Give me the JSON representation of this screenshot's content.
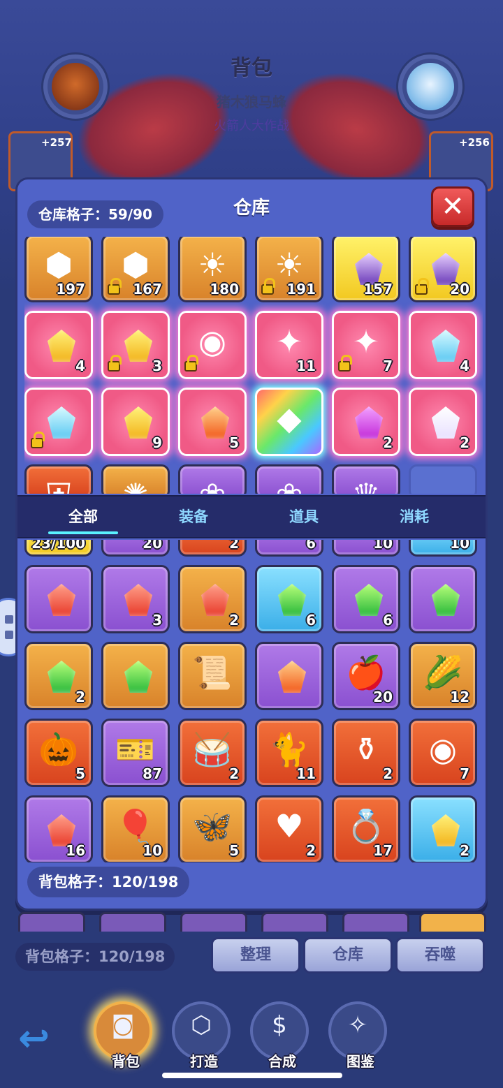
{
  "background": {
    "title": "背包",
    "subtitle": "猪木狼马蜂",
    "subtitle2": "火箭人大作战",
    "left_card_bonus": "+257",
    "right_card_bonus": "+256"
  },
  "warehouse": {
    "title": "仓库",
    "capacity_label": "仓库格子：59/90",
    "close_symbol": "✕",
    "items": [
      {
        "icon": "rune-stone-icon",
        "glyph": "⬢",
        "rarity": "orange",
        "qty": "197",
        "locked": false
      },
      {
        "icon": "rune-stone-icon",
        "glyph": "⬢",
        "rarity": "orange",
        "qty": "167",
        "locked": true
      },
      {
        "icon": "sun-stone-icon",
        "glyph": "☀",
        "rarity": "orange",
        "qty": "180",
        "locked": false
      },
      {
        "icon": "sun-stone-icon",
        "glyph": "☀",
        "rarity": "orange",
        "qty": "191",
        "locked": true
      },
      {
        "icon": "purple-crystal-icon",
        "gem": "purple",
        "rarity": "gold",
        "qty": "157",
        "locked": false
      },
      {
        "icon": "purple-crystal-icon",
        "gem": "purple",
        "rarity": "gold",
        "qty": "20",
        "locked": true
      },
      {
        "icon": "yellow-gem-icon",
        "gem": "yellow",
        "rarity": "pink",
        "qty": "4",
        "locked": false
      },
      {
        "icon": "yellow-gem-icon",
        "gem": "yellow",
        "rarity": "pink",
        "qty": "3",
        "locked": true
      },
      {
        "icon": "purple-orb-icon",
        "glyph": "◉",
        "rarity": "pink",
        "qty": "",
        "locked": true
      },
      {
        "icon": "sparkle-icon",
        "glyph": "✦",
        "rarity": "pink",
        "qty": "11",
        "locked": false
      },
      {
        "icon": "sparkle-icon",
        "glyph": "✦",
        "rarity": "pink",
        "qty": "7",
        "locked": true
      },
      {
        "icon": "ice-crystal-icon",
        "gem": "cyan",
        "rarity": "pink",
        "qty": "4",
        "locked": false
      },
      {
        "icon": "ice-crystal-icon",
        "gem": "cyan",
        "rarity": "pink",
        "qty": "",
        "locked": true
      },
      {
        "icon": "yellow-crystal-icon",
        "gem": "yellow",
        "rarity": "pink",
        "qty": "9",
        "locked": false
      },
      {
        "icon": "orange-crystal-icon",
        "gem": "orange",
        "rarity": "pink",
        "qty": "5",
        "locked": false
      },
      {
        "icon": "diamond-icon",
        "glyph": "◆",
        "rarity": "rainbow",
        "qty": "",
        "locked": false
      },
      {
        "icon": "magenta-gem-icon",
        "gem": "magenta",
        "rarity": "pink",
        "qty": "2",
        "locked": false
      },
      {
        "icon": "gem-cluster-icon",
        "gem": "white",
        "rarity": "pink",
        "qty": "2",
        "locked": false
      },
      {
        "icon": "armor-icon",
        "glyph": "⛨",
        "rarity": "red",
        "qty": "",
        "locked": false,
        "partial": true
      },
      {
        "icon": "golden-helm-icon",
        "glyph": "✺",
        "rarity": "orange",
        "qty": "",
        "locked": false,
        "partial": true
      },
      {
        "icon": "ribbon-icon",
        "glyph": "❀",
        "rarity": "purple",
        "qty": "",
        "locked": false,
        "partial": true
      },
      {
        "icon": "ribbon-icon",
        "glyph": "❀",
        "rarity": "purple",
        "qty": "",
        "locked": false,
        "partial": true
      },
      {
        "icon": "crown-icon",
        "glyph": "♛",
        "rarity": "purple",
        "qty": "",
        "locked": false,
        "partial": true
      },
      {
        "icon": "empty-slot",
        "glyph": "",
        "rarity": "empty",
        "qty": "",
        "locked": false,
        "partial": true
      }
    ]
  },
  "tabs": [
    {
      "label": "全部",
      "active": true
    },
    {
      "label": "装备",
      "active": false
    },
    {
      "label": "道具",
      "active": false
    },
    {
      "label": "消耗",
      "active": false
    }
  ],
  "backpack": {
    "capacity_label": "背包格子：120/198",
    "items": [
      {
        "icon": "partial-item-icon",
        "glyph": "",
        "rarity": "gold",
        "qty": "23/100",
        "partial": true
      },
      {
        "icon": "partial-item-icon",
        "glyph": "",
        "rarity": "purple",
        "qty": "20",
        "partial": true
      },
      {
        "icon": "partial-item-icon",
        "glyph": "",
        "rarity": "red",
        "qty": "2",
        "partial": true
      },
      {
        "icon": "partial-item-icon",
        "glyph": "",
        "rarity": "purple",
        "qty": "6",
        "partial": true
      },
      {
        "icon": "partial-item-icon",
        "glyph": "",
        "rarity": "purple",
        "qty": "10",
        "partial": true
      },
      {
        "icon": "partial-item-icon",
        "glyph": "",
        "rarity": "blue",
        "qty": "10",
        "partial": true
      },
      {
        "icon": "red-shard-icon",
        "gem": "red",
        "rarity": "purple",
        "qty": ""
      },
      {
        "icon": "red-shard-icon",
        "gem": "red",
        "rarity": "purple",
        "qty": "3"
      },
      {
        "icon": "red-shard-icon",
        "gem": "red",
        "rarity": "orange",
        "qty": "2"
      },
      {
        "icon": "green-shard-icon",
        "gem": "green",
        "rarity": "blue",
        "qty": "6"
      },
      {
        "icon": "green-shard-icon",
        "gem": "green",
        "rarity": "purple",
        "qty": "6"
      },
      {
        "icon": "green-shard-icon",
        "gem": "green",
        "rarity": "purple",
        "qty": ""
      },
      {
        "icon": "green-shard-icon",
        "gem": "green",
        "rarity": "orange",
        "qty": "2"
      },
      {
        "icon": "green-cube-icon",
        "gem": "green",
        "rarity": "orange",
        "qty": ""
      },
      {
        "icon": "scroll-icon",
        "glyph": "📜",
        "rarity": "orange",
        "qty": ""
      },
      {
        "icon": "orange-shard-icon",
        "gem": "orange",
        "rarity": "purple",
        "qty": ""
      },
      {
        "icon": "apple-icon",
        "glyph": "🍎",
        "rarity": "purple",
        "qty": "20"
      },
      {
        "icon": "corn-icon",
        "glyph": "🌽",
        "rarity": "orange",
        "qty": "12"
      },
      {
        "icon": "pumpkin-icon",
        "glyph": "🎃",
        "rarity": "red",
        "qty": "5"
      },
      {
        "icon": "ticket-icon",
        "glyph": "🎫",
        "rarity": "purple",
        "qty": "87"
      },
      {
        "icon": "drum-icon",
        "glyph": "🥁",
        "rarity": "red",
        "qty": "2"
      },
      {
        "icon": "black-cat-icon",
        "glyph": "🐈",
        "rarity": "red",
        "qty": "11"
      },
      {
        "icon": "bronze-cauldron-icon",
        "glyph": "⚱",
        "rarity": "red",
        "qty": "2"
      },
      {
        "icon": "dark-orb-icon",
        "glyph": "◉",
        "rarity": "red",
        "qty": "7"
      },
      {
        "icon": "bean-icon",
        "gem": "red",
        "rarity": "purple",
        "qty": "16",
        "partial_bottom": true
      },
      {
        "icon": "heart-balloon-icon",
        "glyph": "🎈",
        "rarity": "orange",
        "qty": "10",
        "partial_bottom": true
      },
      {
        "icon": "crystal-butterfly-icon",
        "glyph": "🦋",
        "rarity": "orange",
        "qty": "5",
        "partial_bottom": true
      },
      {
        "icon": "crystal-heart-icon",
        "glyph": "♥",
        "rarity": "red",
        "qty": "2",
        "partial_bottom": true
      },
      {
        "icon": "ruby-ring-icon",
        "glyph": "💍",
        "rarity": "red",
        "qty": "17",
        "partial_bottom": true
      },
      {
        "icon": "yellow-crystal-icon",
        "gem": "yellow",
        "rarity": "blue",
        "qty": "2",
        "partial_bottom": true
      }
    ]
  },
  "bottom": {
    "capacity_label": "背包格子：120/198",
    "buttons": [
      "整理",
      "仓库",
      "吞噬"
    ]
  },
  "nav": [
    {
      "label": "背包",
      "icon": "backpack-icon",
      "glyph": "◙",
      "active": true
    },
    {
      "label": "打造",
      "icon": "forge-box-icon",
      "glyph": "⬡",
      "active": false
    },
    {
      "label": "合成",
      "icon": "synthesis-icon",
      "glyph": "$",
      "active": false
    },
    {
      "label": "图鉴",
      "icon": "codex-icon",
      "glyph": "✧",
      "active": false
    }
  ],
  "back_glyph": "↩"
}
